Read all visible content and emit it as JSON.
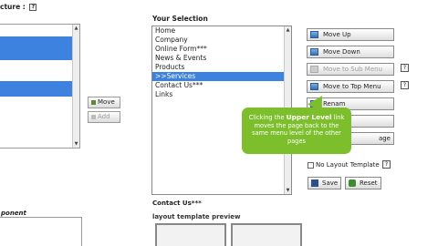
{
  "header": {
    "structure_label": "cture :",
    "help": "?"
  },
  "left_list": {
    "rows": [
      "",
      "",
      "",
      "",
      "",
      "",
      "",
      "",
      "",
      ""
    ]
  },
  "middle": {
    "move_label": "Move",
    "add_label": "Add"
  },
  "selection": {
    "title": "Your Selection",
    "items": [
      {
        "label": "Home",
        "selected": false
      },
      {
        "label": "Company",
        "selected": false
      },
      {
        "label": "Online Form***",
        "selected": false
      },
      {
        "label": "News & Events",
        "selected": false
      },
      {
        "label": "Products",
        "selected": false
      },
      {
        "label": ">>Services",
        "selected": true
      },
      {
        "label": "Contact Us***",
        "selected": false
      },
      {
        "label": "Links",
        "selected": false
      }
    ]
  },
  "buttons": {
    "move_up": "Move Up",
    "move_down": "Move Down",
    "move_to_sub_menu": "Move to Sub Menu",
    "move_to_top_menu": "Move to Top Menu",
    "rename_partial": "Renam",
    "age_partial": "age",
    "help": "?"
  },
  "tooltip": {
    "line1_pre": "Clicking the ",
    "line1_bold": "Upper Level",
    "line1_post": " link",
    "line2": "moves the page back to the",
    "line3": "same menu level of the other",
    "line4": "pages"
  },
  "layout_template": {
    "label": "No Layout Template",
    "checked": false,
    "help": "?"
  },
  "actions": {
    "save": "Save",
    "reset": "Reset"
  },
  "bottom": {
    "component_label": "ponent",
    "contact_title": "Contact Us***",
    "preview_label": "layout template preview"
  },
  "colors": {
    "selection_blue": "#3d82de",
    "tooltip_green": "#7dbe2c"
  }
}
